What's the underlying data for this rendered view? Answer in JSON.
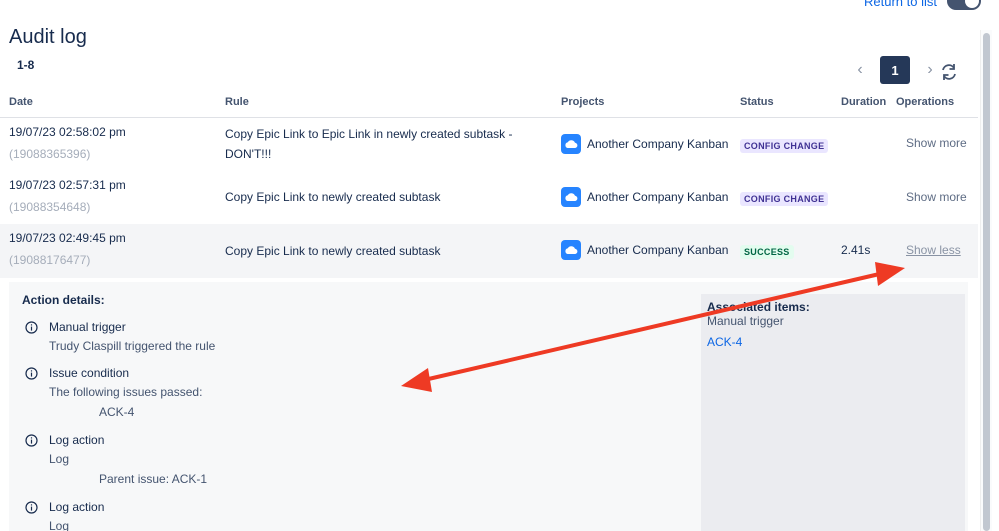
{
  "top": {
    "toggle_label": "Return to list"
  },
  "page": {
    "title": "Audit log",
    "range": "1-8"
  },
  "pagination": {
    "prev": "‹",
    "current": "1",
    "next": "›"
  },
  "columns": {
    "date": "Date",
    "rule": "Rule",
    "projects": "Projects",
    "status": "Status",
    "duration": "Duration",
    "operations": "Operations"
  },
  "rows": [
    {
      "date": "19/07/23 02:58:02 pm",
      "id": "(19088365396)",
      "rule_line1": "Copy Epic Link to Epic Link in newly created subtask -",
      "rule_line2": "DON'T!!!",
      "project": "Another Company Kanban",
      "status": "CONFIG CHANGE",
      "duration": "",
      "operation": "Show more"
    },
    {
      "date": "19/07/23 02:57:31 pm",
      "id": "(19088354648)",
      "rule_line1": "Copy Epic Link to newly created subtask",
      "project": "Another Company Kanban",
      "status": "CONFIG CHANGE",
      "duration": "",
      "operation": "Show more"
    },
    {
      "date": "19/07/23 02:49:45 pm",
      "id": "(19088176477)",
      "rule_line1": "Copy Epic Link to newly created subtask",
      "project": "Another Company Kanban",
      "status": "SUCCESS",
      "duration": "2.41s",
      "operation": "Show less"
    }
  ],
  "details": {
    "heading": "Action details:",
    "items": [
      {
        "title": "Manual trigger",
        "sub": "Trudy Claspill triggered the rule",
        "sub2": ""
      },
      {
        "title": "Issue condition",
        "sub": "The following issues passed:",
        "sub2": "ACK-4"
      },
      {
        "title": "Log action",
        "sub": "Log",
        "sub2": "Parent issue: ACK-1"
      },
      {
        "title": "Log action",
        "sub": "Log",
        "sub2": ""
      }
    ],
    "associated": {
      "heading": "Associated items:",
      "sub": "Manual trigger",
      "link": "ACK-4"
    }
  },
  "colors": {
    "arrow": "#ee3a24",
    "brand": "#2684ff",
    "pager_active": "#253858",
    "link": "#0c66e4"
  }
}
